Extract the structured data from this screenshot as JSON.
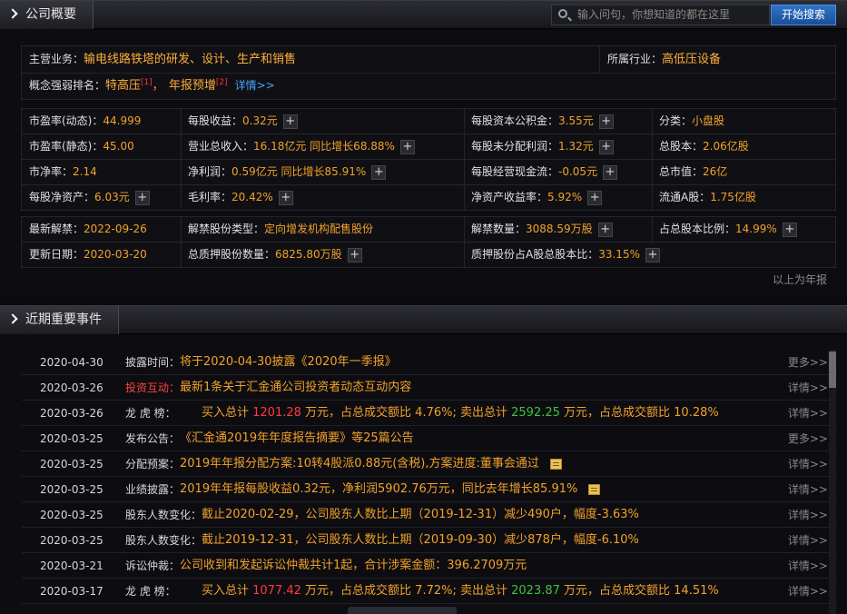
{
  "header1": {
    "title": "公司概要"
  },
  "search": {
    "placeholder": "输入问句，你想知道的都在这里",
    "button": "开始搜索"
  },
  "business": {
    "label": "主营业务：",
    "value": "输电线路铁塔的研发、设计、生产和销售",
    "industry_label": "所属行业：",
    "industry": "高低压设备",
    "concept_label": "概念强弱排名：",
    "concept1": "特高压",
    "concept1_rank": "1",
    "sep": "，",
    "concept2": "年报预增",
    "concept2_rank": "2",
    "detail": "详情>>"
  },
  "metrics": {
    "r1": [
      {
        "label": "市盈率(动态)：",
        "value": "44.999"
      },
      {
        "label": "每股收益：",
        "value": "0.32元"
      },
      {
        "label": "每股资本公积金：",
        "value": "3.55元"
      },
      {
        "label": "分类：",
        "value": "小盘股"
      }
    ],
    "r2": [
      {
        "label": "市盈率(静态)：",
        "value": "45.00"
      },
      {
        "label": "营业总收入：",
        "value": "16.18亿元 同比增长68.88%"
      },
      {
        "label": "每股未分配利润：",
        "value": "1.32元"
      },
      {
        "label": "总股本：",
        "value": "2.06亿股"
      }
    ],
    "r3": [
      {
        "label": "市净率：",
        "value": "2.14"
      },
      {
        "label": "净利润：",
        "value": "0.59亿元 同比增长85.91%"
      },
      {
        "label": "每股经营现金流：",
        "value": "-0.05元"
      },
      {
        "label": "总市值：",
        "value": "26亿"
      }
    ],
    "r4": [
      {
        "label": "每股净资产：",
        "value": "6.03元"
      },
      {
        "label": "毛利率：",
        "value": "20.42%"
      },
      {
        "label": "净资产收益率：",
        "value": "5.92%"
      },
      {
        "label": "流通A股：",
        "value": "1.75亿股"
      }
    ]
  },
  "unlock": {
    "r1": [
      {
        "label": "最新解禁：",
        "value": "2022-09-26"
      },
      {
        "label": "解禁股份类型：",
        "value": "定向增发机构配售股份"
      },
      {
        "label": "解禁数量：",
        "value": "3088.59万股"
      },
      {
        "label": "占总股本比例：",
        "value": "14.99%"
      }
    ],
    "r2": [
      {
        "label": "更新日期：",
        "value": "2020-03-20"
      },
      {
        "label": "总质押股份数量：",
        "value": "6825.80万股"
      },
      {
        "label": "质押股份占A股总股本比：",
        "value": "33.15%"
      }
    ],
    "footnote": "以上为年报"
  },
  "header2": {
    "title": "近期重要事件"
  },
  "events": [
    {
      "date": "2020-04-30",
      "cat": "披露时间：",
      "text": "将于2020-04-30披露《2020年一季报》",
      "more": "更多>>"
    },
    {
      "date": "2020-03-26",
      "cat": "投资互动：",
      "text": "最新1条关于汇金通公司投资者动态互动内容",
      "more": "详情>>"
    },
    {
      "date": "2020-03-26",
      "cat": "龙 虎 榜：",
      "t1": "买入总计 ",
      "buy": "1201.28",
      "t2": " 万元，占总成交额比 4.76%; 卖出总计 ",
      "sell": "2592.25",
      "t3": " 万元，占总成交额比 10.28%",
      "more": "详情>>"
    },
    {
      "date": "2020-03-25",
      "cat": "发布公告：",
      "text": "《汇金通2019年年度报告摘要》等25篇公告",
      "more": "更多>>"
    },
    {
      "date": "2020-03-25",
      "cat": "分配预案：",
      "text": "2019年年报分配方案:10转4股派0.88元(含税),方案进度:董事会通过",
      "more": "详情>>"
    },
    {
      "date": "2020-03-25",
      "cat": "业绩披露：",
      "text": "2019年年报每股收益0.32元，净利润5902.76万元，同比去年增长85.91%",
      "more": "详情>>"
    },
    {
      "date": "2020-03-25",
      "cat": "股东人数变化：",
      "text": "截止2020-02-29，公司股东人数比上期（2019-12-31）减少490户，幅度-3.63%",
      "more": "详情>>"
    },
    {
      "date": "2020-03-25",
      "cat": "股东人数变化：",
      "text": "截止2019-12-31，公司股东人数比上期（2019-09-30）减少878户，幅度-6.10%",
      "more": "详情>>"
    },
    {
      "date": "2020-03-21",
      "cat": "诉讼仲裁：",
      "text": "公司收到和发起诉讼仲裁共计1起，合计涉案金额：396.2709万元",
      "more": "详情>>"
    },
    {
      "date": "2020-03-17",
      "cat": "龙 虎 榜：",
      "t1": "买入总计 ",
      "buy": "1077.42",
      "t2": " 万元，占总成交额比 7.72%; 卖出总计 ",
      "sell": "2023.87",
      "t3": " 万元，占总成交额比 14.51%",
      "more": "详情>>"
    }
  ],
  "colors": {
    "accent": "#f2a12a",
    "link": "#4aa3ff",
    "buy": "#ff3b3b",
    "sell": "#3ec33e"
  }
}
